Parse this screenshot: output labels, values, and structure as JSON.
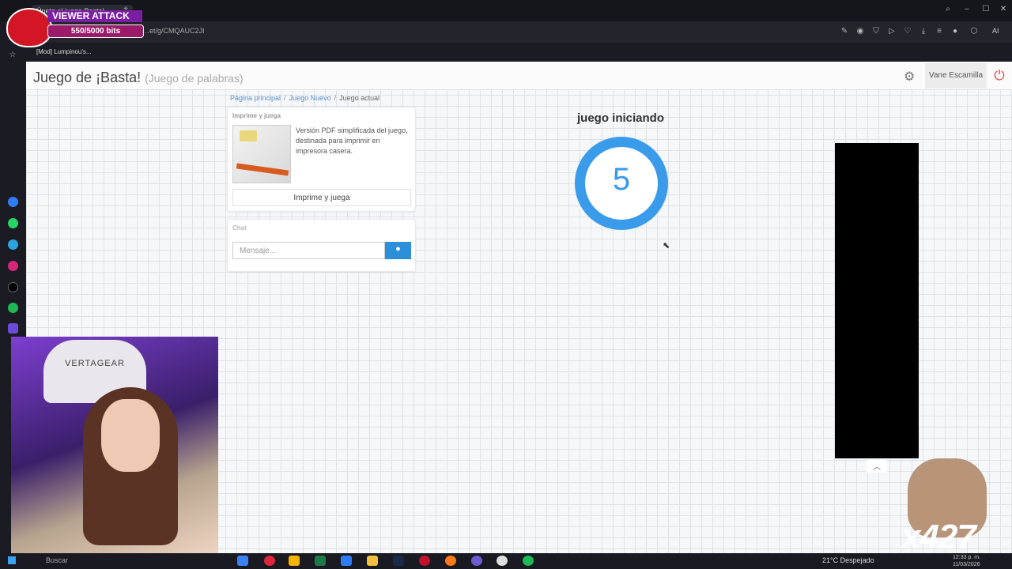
{
  "browser": {
    "tab_title": "Únete al juego Basta!",
    "url": "…et/g/CMQAUC2JI",
    "bookmark": "[Mod] Lumpinou's...",
    "ai_label": "AI"
  },
  "page": {
    "title": "Juego de ¡Basta!",
    "subtitle": "(Juego de palabras)",
    "username": "Vane Escamilla",
    "breadcrumb": [
      "Página principal",
      "Juego Nuevo",
      "Juego actual"
    ],
    "print_panel": {
      "title": "Imprime y juega",
      "description": "Versión PDF simplificada del juego, destinada para imprimir en impresora casera.",
      "button": "Imprime y juega"
    },
    "chat_panel": {
      "title": "Chat",
      "placeholder": "Mensaje..."
    },
    "status": "juego iniciando",
    "countdown": "5"
  },
  "overlay": {
    "viewer_attack": "VIEWER ATTACK",
    "bits": "550/5000 bits",
    "multiplier": "x427",
    "chair_brand": "VERTAGEAR"
  },
  "taskbar": {
    "search": "Buscar",
    "weather": "21°C  Despejado",
    "time": "12:33 p. m.",
    "date": "11/03/2026"
  },
  "colors": {
    "accent": "#3a9bea",
    "brand_purple": "#7b1fa2"
  }
}
